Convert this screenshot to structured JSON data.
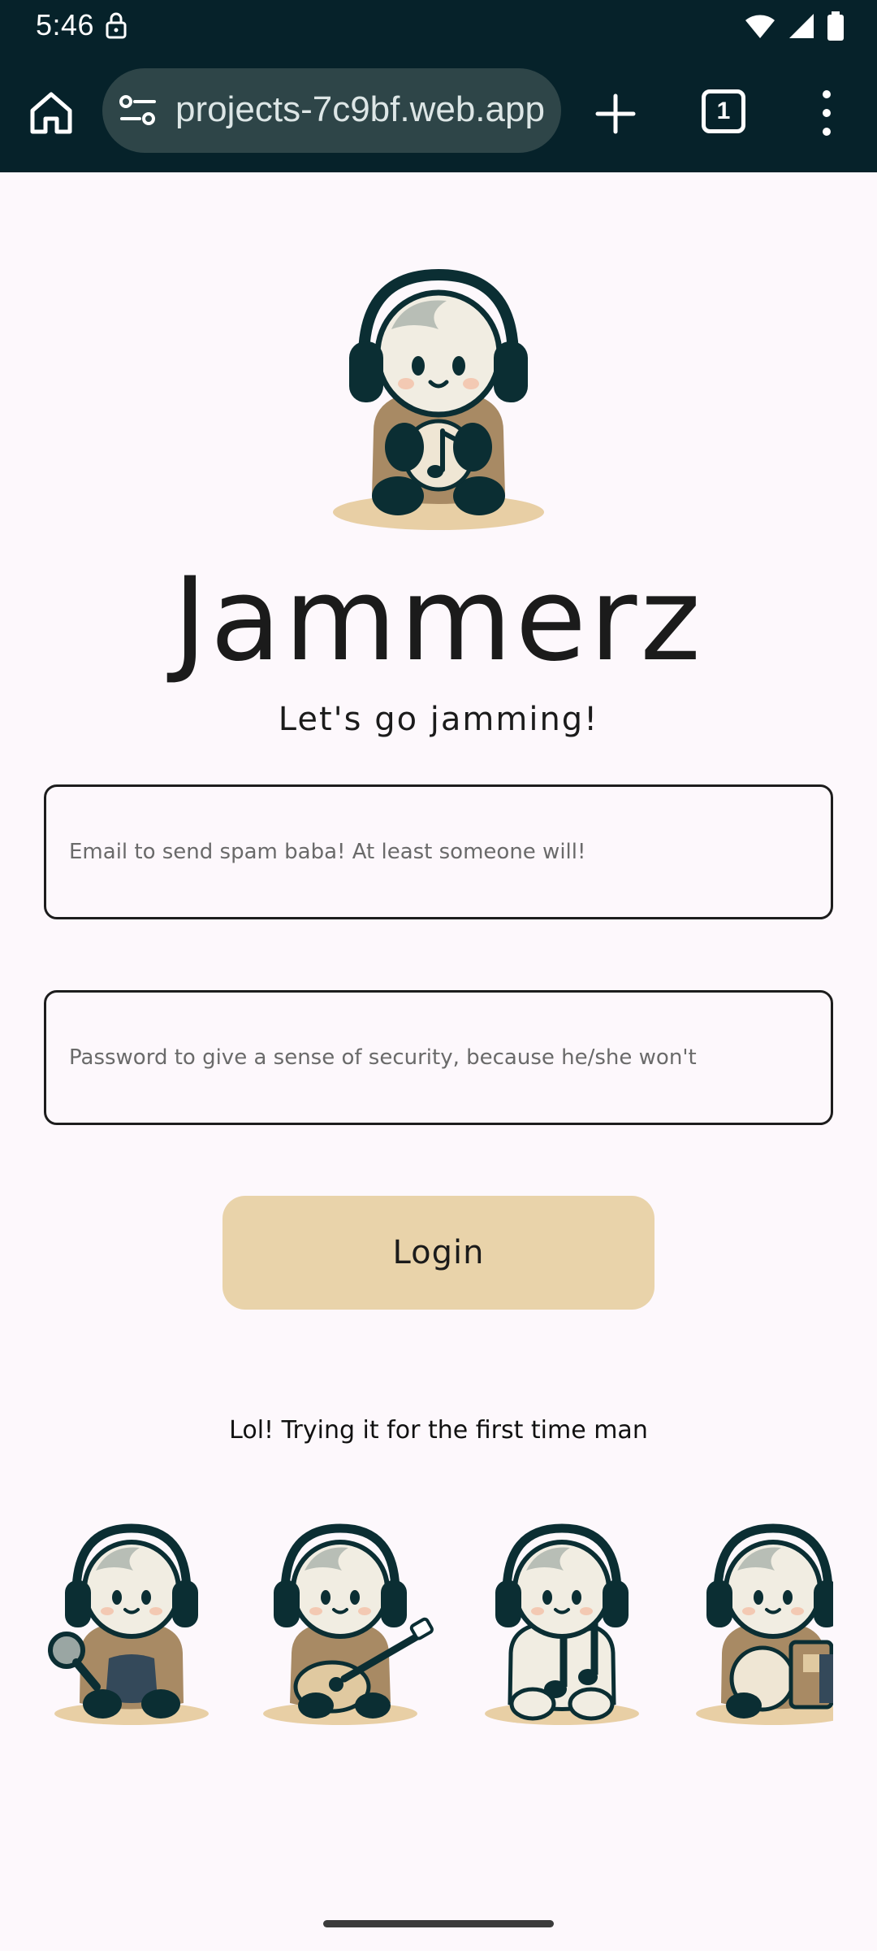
{
  "status_bar": {
    "time": "5:46",
    "icons": [
      "lock-icon",
      "wifi-icon",
      "cellular-signal-icon",
      "battery-icon"
    ]
  },
  "browser": {
    "url": "projects-7c9bf.web.app",
    "tab_count": "1",
    "icons": [
      "home-icon",
      "site-info-icon",
      "plus-icon",
      "tab-switcher-icon",
      "more-vertical-icon"
    ]
  },
  "app": {
    "title": "Jammerz",
    "tagline": "Let's go jamming!"
  },
  "form": {
    "email_placeholder": "Email to send spam baba! At least someone will!",
    "password_placeholder": "Password to give a sense of security, because he/she won't",
    "login_label": "Login"
  },
  "footer": {
    "first_time_text": "Lol! Trying it for the first time man"
  },
  "colors": {
    "status_bar_bg": "#06222a",
    "url_pill_bg": "#2e4548",
    "page_bg": "#fdf8fc",
    "login_button_bg": "#e9d3aa",
    "mascot_dark": "#0b2e33",
    "mascot_tan": "#a88a64"
  }
}
